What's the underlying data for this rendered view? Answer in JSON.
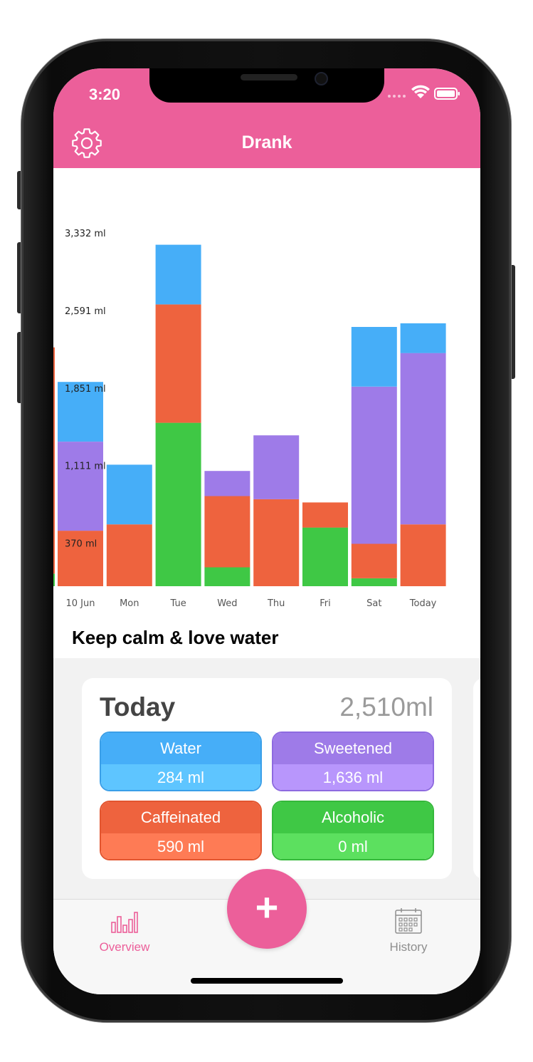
{
  "status_bar": {
    "time": "3:20"
  },
  "nav": {
    "title": "Drank"
  },
  "colors": {
    "accent": "#ec5f9a",
    "water": "#46aef8",
    "sweetened": "#9e7be8",
    "caffeinated": "#ee633e",
    "alcoholic": "#3fc845"
  },
  "chart_data": {
    "type": "bar",
    "stacked": true,
    "categories": [
      "10 Jun",
      "Mon",
      "Tue",
      "Wed",
      "Thu",
      "Fri",
      "Sat",
      "Today"
    ],
    "y_tick_labels": [
      "3,332  ml",
      "2,591  ml",
      "1,851  ml",
      "1,111  ml",
      "370  ml"
    ],
    "y_ticks": [
      3332,
      2591,
      1851,
      1111,
      370
    ],
    "ylim": [
      0,
      3400
    ],
    "series": [
      {
        "key": "alcoholic",
        "values": [
          0,
          0,
          1560,
          180,
          0,
          560,
          75,
          0
        ]
      },
      {
        "key": "caffeinated",
        "values": [
          530,
          590,
          1130,
          680,
          830,
          240,
          330,
          590
        ]
      },
      {
        "key": "sweetened",
        "values": [
          850,
          0,
          0,
          240,
          610,
          0,
          1500,
          1636
        ]
      },
      {
        "key": "water",
        "values": [
          570,
          570,
          570,
          0,
          0,
          0,
          570,
          284
        ]
      }
    ],
    "grid": false,
    "legend": "none"
  },
  "motto": "Keep calm & love water",
  "today_card": {
    "title": "Today",
    "total": "2,510ml",
    "categories": [
      {
        "label": "Water",
        "amount": "284 ml"
      },
      {
        "label": "Sweetened",
        "amount": "1,636 ml"
      },
      {
        "label": "Caffeinated",
        "amount": "590 ml"
      },
      {
        "label": "Alcoholic",
        "amount": "0 ml"
      }
    ]
  },
  "tabbar": {
    "overview": "Overview",
    "history": "History",
    "add": "+"
  },
  "icons": {
    "settings": "gear-icon",
    "overview": "bar-chart-icon",
    "history": "calendar-icon",
    "add": "plus-icon"
  }
}
